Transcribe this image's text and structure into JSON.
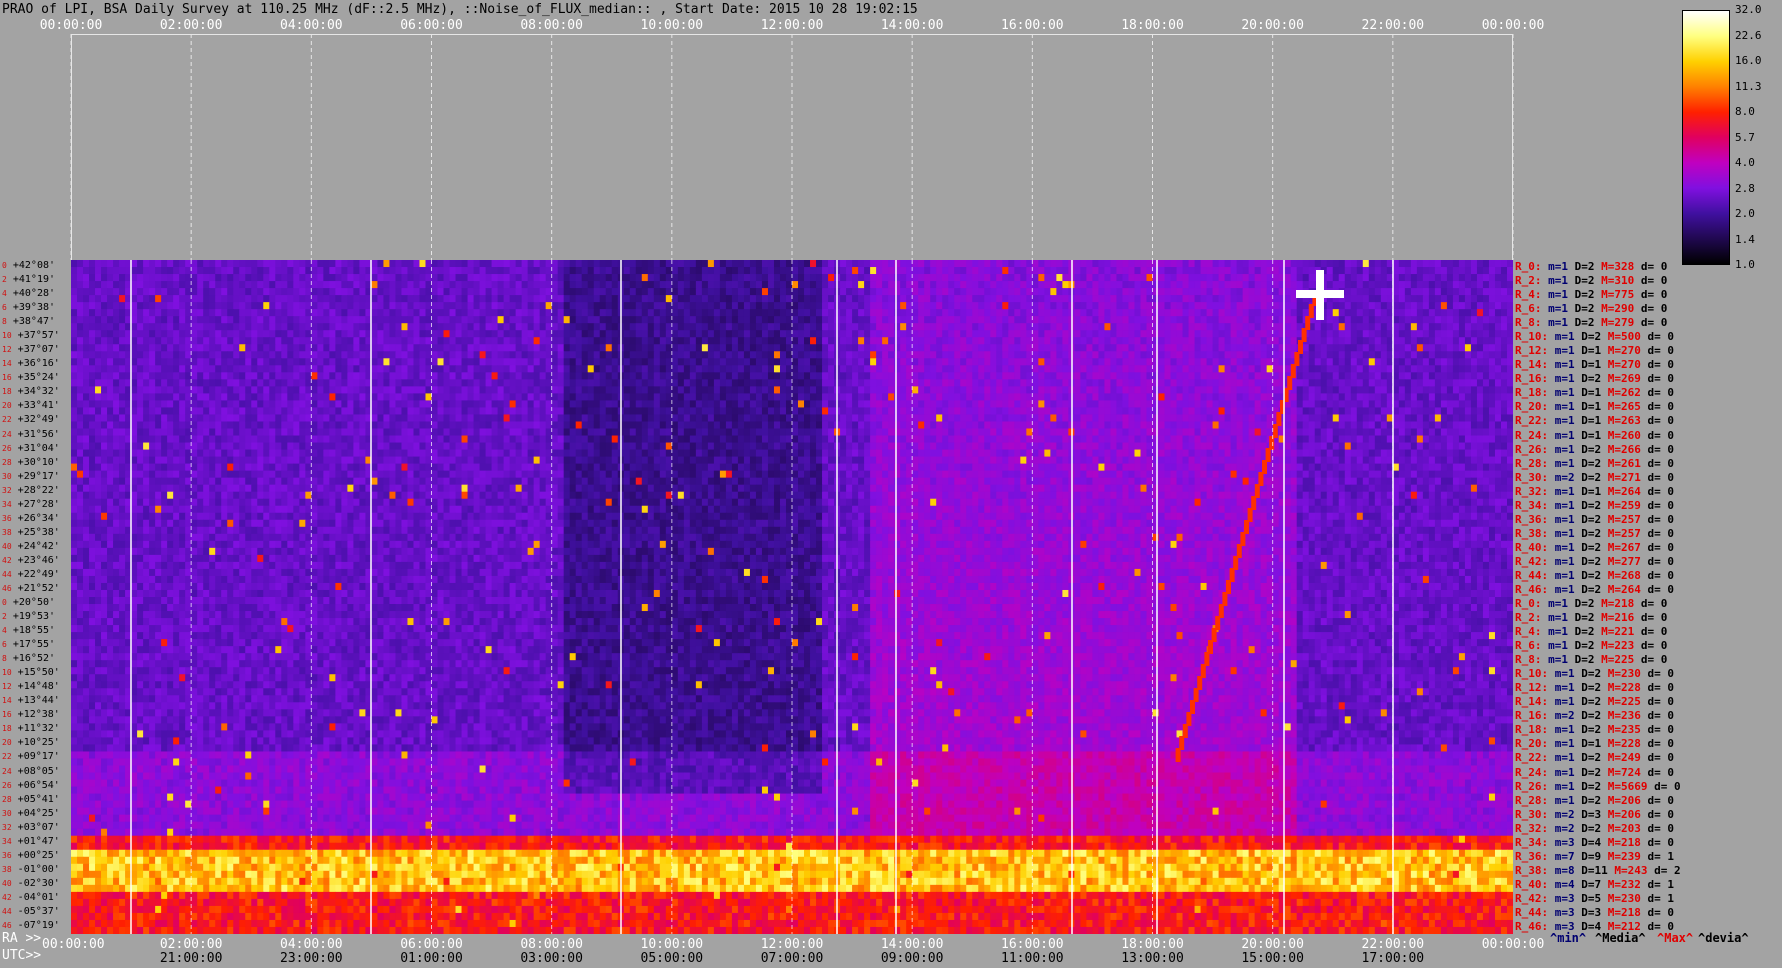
{
  "title": "PRAO of LPI, BSA Daily Survey at 110.25 MHz (dF::2.5 MHz), ::Noise_of_FLUX_median:: , Start Date: 2015 10 28 19:02:15",
  "chart_data": {
    "type": "heatmap",
    "title": "PRAO of LPI, BSA Daily Survey at 110.25 MHz (dF::2.5 MHz), ::Noise_of_FLUX_median:: , Start Date: 2015 10 28 19:02:15",
    "x_top_ticks": [
      "00:00:00",
      "02:00:00",
      "04:00:00",
      "06:00:00",
      "08:00:00",
      "10:00:00",
      "12:00:00",
      "14:00:00",
      "16:00:00",
      "18:00:00",
      "20:00:00",
      "22:00:00",
      "00:00:00"
    ],
    "x_bottom_label_ra": "RA >>",
    "x_bottom_ticks_ra": [
      "00:00:00",
      "02:00:00",
      "04:00:00",
      "06:00:00",
      "08:00:00",
      "10:00:00",
      "12:00:00",
      "14:00:00",
      "16:00:00",
      "18:00:00",
      "20:00:00",
      "22:00:00",
      "00:00:00"
    ],
    "x_bottom_label_utc": "UTC>>",
    "x_bottom_ticks_utc": [
      "21:00:00",
      "23:00:00",
      "01:00:00",
      "03:00:00",
      "05:00:00",
      "07:00:00",
      "09:00:00",
      "11:00:00",
      "13:00:00",
      "15:00:00",
      "17:00:00"
    ],
    "y_ticks": [
      "+42°08'",
      "+41°19'",
      "+40°28'",
      "+39°38'",
      "+38°47'",
      "+37°57'",
      "+37°07'",
      "+36°16'",
      "+35°24'",
      "+34°32'",
      "+33°41'",
      "+32°49'",
      "+31°56'",
      "+31°04'",
      "+30°10'",
      "+29°17'",
      "+28°22'",
      "+27°28'",
      "+26°34'",
      "+25°38'",
      "+24°42'",
      "+23°46'",
      "+22°49'",
      "+21°52'",
      "+20°50'",
      "+19°53'",
      "+18°55'",
      "+17°55'",
      "+16°52'",
      "+15°50'",
      "+14°48'",
      "+13°44'",
      "+12°38'",
      "+11°32'",
      "+10°25'",
      "+09°17'",
      "+08°05'",
      "+06°54'",
      "+05°41'",
      "+04°25'",
      "+03°07'",
      "+01°47'",
      "+00°25'",
      "-01°00'",
      "-02°30'",
      "-04°01'",
      "-05°37'",
      "-07°19'"
    ],
    "row_indices": [
      "0",
      "2",
      "4",
      "6",
      "8",
      "10",
      "12",
      "14",
      "16",
      "18",
      "20",
      "22",
      "24",
      "26",
      "28",
      "30",
      "32",
      "34",
      "36",
      "38",
      "40",
      "42",
      "44",
      "46",
      "0",
      "2",
      "4",
      "6",
      "8",
      "10",
      "12",
      "14",
      "16",
      "18",
      "20",
      "22",
      "24",
      "26",
      "28",
      "30",
      "32",
      "34",
      "36",
      "38",
      "40",
      "42",
      "44",
      "46"
    ],
    "colorbar": {
      "ticks": [
        "32.0",
        "22.6",
        "16.0",
        "11.3",
        "8.0",
        "5.7",
        "4.0",
        "2.8",
        "2.0",
        "1.4",
        "1.0"
      ],
      "scale": "log",
      "range": [
        1.0,
        32.0
      ],
      "colors": [
        "#ffffff",
        "#ffff80",
        "#ffd000",
        "#ff8000",
        "#ff2000",
        "#e00060",
        "#c000c0",
        "#8010e0",
        "#4010a0",
        "#200850",
        "#000000"
      ]
    },
    "stats": [
      {
        "r": "R_0:",
        "m": "m=1",
        "d": "D=2",
        "M": "M=328",
        "dd": "d= 0"
      },
      {
        "r": "R_2:",
        "m": "m=1",
        "d": "D=2",
        "M": "M=310",
        "dd": "d= 0"
      },
      {
        "r": "R_4:",
        "m": "m=1",
        "d": "D=2",
        "M": "M=775",
        "dd": "d= 0"
      },
      {
        "r": "R_6:",
        "m": "m=1",
        "d": "D=2",
        "M": "M=290",
        "dd": "d= 0"
      },
      {
        "r": "R_8:",
        "m": "m=1",
        "d": "D=2",
        "M": "M=279",
        "dd": "d= 0"
      },
      {
        "r": "R_10:",
        "m": "m=1",
        "d": "D=2",
        "M": "M=500",
        "dd": "d= 0"
      },
      {
        "r": "R_12:",
        "m": "m=1",
        "d": "D=1",
        "M": "M=270",
        "dd": "d= 0"
      },
      {
        "r": "R_14:",
        "m": "m=1",
        "d": "D=1",
        "M": "M=270",
        "dd": "d= 0"
      },
      {
        "r": "R_16:",
        "m": "m=1",
        "d": "D=2",
        "M": "M=269",
        "dd": "d= 0"
      },
      {
        "r": "R_18:",
        "m": "m=1",
        "d": "D=1",
        "M": "M=262",
        "dd": "d= 0"
      },
      {
        "r": "R_20:",
        "m": "m=1",
        "d": "D=1",
        "M": "M=265",
        "dd": "d= 0"
      },
      {
        "r": "R_22:",
        "m": "m=1",
        "d": "D=1",
        "M": "M=263",
        "dd": "d= 0"
      },
      {
        "r": "R_24:",
        "m": "m=1",
        "d": "D=1",
        "M": "M=260",
        "dd": "d= 0"
      },
      {
        "r": "R_26:",
        "m": "m=1",
        "d": "D=2",
        "M": "M=266",
        "dd": "d= 0"
      },
      {
        "r": "R_28:",
        "m": "m=1",
        "d": "D=2",
        "M": "M=261",
        "dd": "d= 0"
      },
      {
        "r": "R_30:",
        "m": "m=2",
        "d": "D=2",
        "M": "M=271",
        "dd": "d= 0"
      },
      {
        "r": "R_32:",
        "m": "m=1",
        "d": "D=1",
        "M": "M=264",
        "dd": "d= 0"
      },
      {
        "r": "R_34:",
        "m": "m=1",
        "d": "D=2",
        "M": "M=259",
        "dd": "d= 0"
      },
      {
        "r": "R_36:",
        "m": "m=1",
        "d": "D=2",
        "M": "M=257",
        "dd": "d= 0"
      },
      {
        "r": "R_38:",
        "m": "m=1",
        "d": "D=2",
        "M": "M=257",
        "dd": "d= 0"
      },
      {
        "r": "R_40:",
        "m": "m=1",
        "d": "D=2",
        "M": "M=267",
        "dd": "d= 0"
      },
      {
        "r": "R_42:",
        "m": "m=1",
        "d": "D=2",
        "M": "M=277",
        "dd": "d= 0"
      },
      {
        "r": "R_44:",
        "m": "m=1",
        "d": "D=2",
        "M": "M=268",
        "dd": "d= 0"
      },
      {
        "r": "R_46:",
        "m": "m=1",
        "d": "D=2",
        "M": "M=264",
        "dd": "d= 0"
      },
      {
        "r": "R_0:",
        "m": "m=1",
        "d": "D=2",
        "M": "M=218",
        "dd": "d= 0"
      },
      {
        "r": "R_2:",
        "m": "m=1",
        "d": "D=2",
        "M": "M=216",
        "dd": "d= 0"
      },
      {
        "r": "R_4:",
        "m": "m=1",
        "d": "D=2",
        "M": "M=221",
        "dd": "d= 0"
      },
      {
        "r": "R_6:",
        "m": "m=1",
        "d": "D=2",
        "M": "M=223",
        "dd": "d= 0"
      },
      {
        "r": "R_8:",
        "m": "m=1",
        "d": "D=2",
        "M": "M=225",
        "dd": "d= 0"
      },
      {
        "r": "R_10:",
        "m": "m=1",
        "d": "D=2",
        "M": "M=230",
        "dd": "d= 0"
      },
      {
        "r": "R_12:",
        "m": "m=1",
        "d": "D=2",
        "M": "M=228",
        "dd": "d= 0"
      },
      {
        "r": "R_14:",
        "m": "m=1",
        "d": "D=2",
        "M": "M=225",
        "dd": "d= 0"
      },
      {
        "r": "R_16:",
        "m": "m=2",
        "d": "D=2",
        "M": "M=236",
        "dd": "d= 0"
      },
      {
        "r": "R_18:",
        "m": "m=1",
        "d": "D=2",
        "M": "M=235",
        "dd": "d= 0"
      },
      {
        "r": "R_20:",
        "m": "m=1",
        "d": "D=1",
        "M": "M=228",
        "dd": "d= 0"
      },
      {
        "r": "R_22:",
        "m": "m=1",
        "d": "D=2",
        "M": "M=249",
        "dd": "d= 0"
      },
      {
        "r": "R_24:",
        "m": "m=1",
        "d": "D=2",
        "M": "M=724",
        "dd": "d= 0"
      },
      {
        "r": "R_26:",
        "m": "m=1",
        "d": "D=2",
        "M": "M=5669",
        "dd": "d= 0"
      },
      {
        "r": "R_28:",
        "m": "m=1",
        "d": "D=2",
        "M": "M=206",
        "dd": "d= 0"
      },
      {
        "r": "R_30:",
        "m": "m=2",
        "d": "D=3",
        "M": "M=206",
        "dd": "d= 0"
      },
      {
        "r": "R_32:",
        "m": "m=2",
        "d": "D=2",
        "M": "M=203",
        "dd": "d= 0"
      },
      {
        "r": "R_34:",
        "m": "m=3",
        "d": "D=4",
        "M": "M=218",
        "dd": "d= 0"
      },
      {
        "r": "R_36:",
        "m": "m=7",
        "d": "D=9",
        "M": "M=239",
        "dd": "d= 1"
      },
      {
        "r": "R_38:",
        "m": "m=8",
        "d": "D=11",
        "M": "M=243",
        "dd": "d= 2"
      },
      {
        "r": "R_40:",
        "m": "m=4",
        "d": "D=7",
        "M": "M=232",
        "dd": "d= 1"
      },
      {
        "r": "R_42:",
        "m": "m=3",
        "d": "D=5",
        "M": "M=230",
        "dd": "d= 1"
      },
      {
        "r": "R_44:",
        "m": "m=3",
        "d": "D=3",
        "M": "M=218",
        "dd": "d= 0"
      },
      {
        "r": "R_46:",
        "m": "m=3",
        "d": "D=4",
        "M": "M=212",
        "dd": "d= 0"
      }
    ],
    "legend_captions": [
      {
        "text": "^min^",
        "color": "#000070"
      },
      {
        "text": "^Media^",
        "color": "#000000"
      },
      {
        "text": "^Max^",
        "color": "#e00000"
      },
      {
        "text": "^devia^",
        "color": "#000000"
      }
    ]
  }
}
